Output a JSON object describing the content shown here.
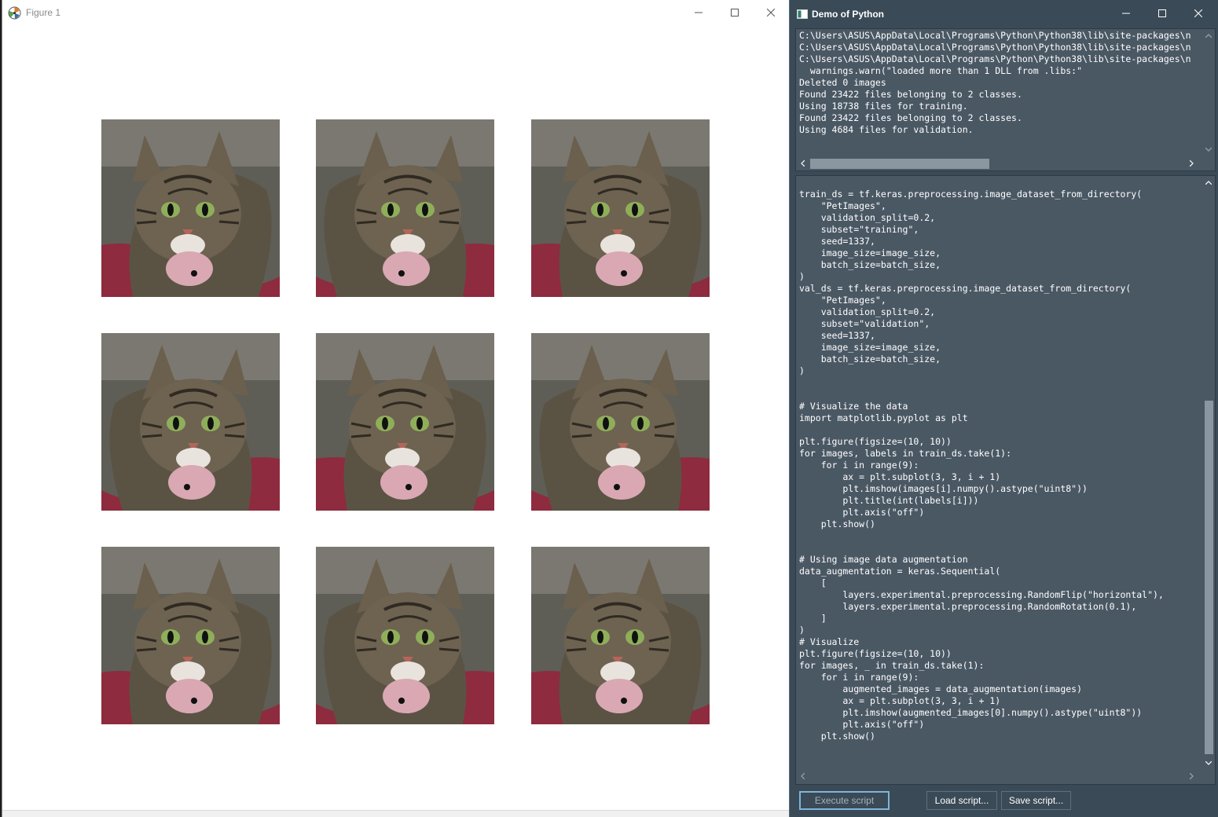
{
  "figure_window": {
    "title": "Figure 1",
    "image_count": 9
  },
  "python_window": {
    "title": "Demo of Python",
    "output_lines": [
      "C:\\Users\\ASUS\\AppData\\Local\\Programs\\Python\\Python38\\lib\\site-packages\\n",
      "C:\\Users\\ASUS\\AppData\\Local\\Programs\\Python\\Python38\\lib\\site-packages\\n",
      "C:\\Users\\ASUS\\AppData\\Local\\Programs\\Python\\Python38\\lib\\site-packages\\n",
      "  warnings.warn(\"loaded more than 1 DLL from .libs:\"",
      "Deleted 0 images",
      "Found 23422 files belonging to 2 classes.",
      "Using 18738 files for training.",
      "Found 23422 files belonging to 2 classes.",
      "Using 4684 files for validation."
    ],
    "code_lines": [
      "train_ds = tf.keras.preprocessing.image_dataset_from_directory(",
      "    \"PetImages\",",
      "    validation_split=0.2,",
      "    subset=\"training\",",
      "    seed=1337,",
      "    image_size=image_size,",
      "    batch_size=batch_size,",
      ")",
      "val_ds = tf.keras.preprocessing.image_dataset_from_directory(",
      "    \"PetImages\",",
      "    validation_split=0.2,",
      "    subset=\"validation\",",
      "    seed=1337,",
      "    image_size=image_size,",
      "    batch_size=batch_size,",
      ")",
      "",
      "",
      "# Visualize the data",
      "import matplotlib.pyplot as plt",
      "",
      "plt.figure(figsize=(10, 10))",
      "for images, labels in train_ds.take(1):",
      "    for i in range(9):",
      "        ax = plt.subplot(3, 3, i + 1)",
      "        plt.imshow(images[i].numpy().astype(\"uint8\"))",
      "        plt.title(int(labels[i]))",
      "        plt.axis(\"off\")",
      "    plt.show()",
      "",
      "",
      "# Using image data augmentation",
      "data_augmentation = keras.Sequential(",
      "    [",
      "        layers.experimental.preprocessing.RandomFlip(\"horizontal\"),",
      "        layers.experimental.preprocessing.RandomRotation(0.1),",
      "    ]",
      ")",
      "# Visualize",
      "plt.figure(figsize=(10, 10))",
      "for images, _ in train_ds.take(1):",
      "    for i in range(9):",
      "        augmented_images = data_augmentation(images)",
      "        ax = plt.subplot(3, 3, i + 1)",
      "        plt.imshow(augmented_images[0].numpy().astype(\"uint8\"))",
      "        plt.axis(\"off\")",
      "    plt.show()"
    ],
    "buttons": {
      "execute": "Execute script",
      "load": "Load script...",
      "save": "Save script..."
    }
  },
  "icons": [
    "figure-logo-icon",
    "minimize-icon",
    "maximize-icon",
    "close-icon",
    "app-icon",
    "scroll-up-icon",
    "scroll-down-icon",
    "scroll-left-icon",
    "scroll-right-icon"
  ],
  "colors": {
    "python_bg": "#3a4a56",
    "panel_bg": "#4a5864",
    "accent_border": "#7fb4d6"
  }
}
